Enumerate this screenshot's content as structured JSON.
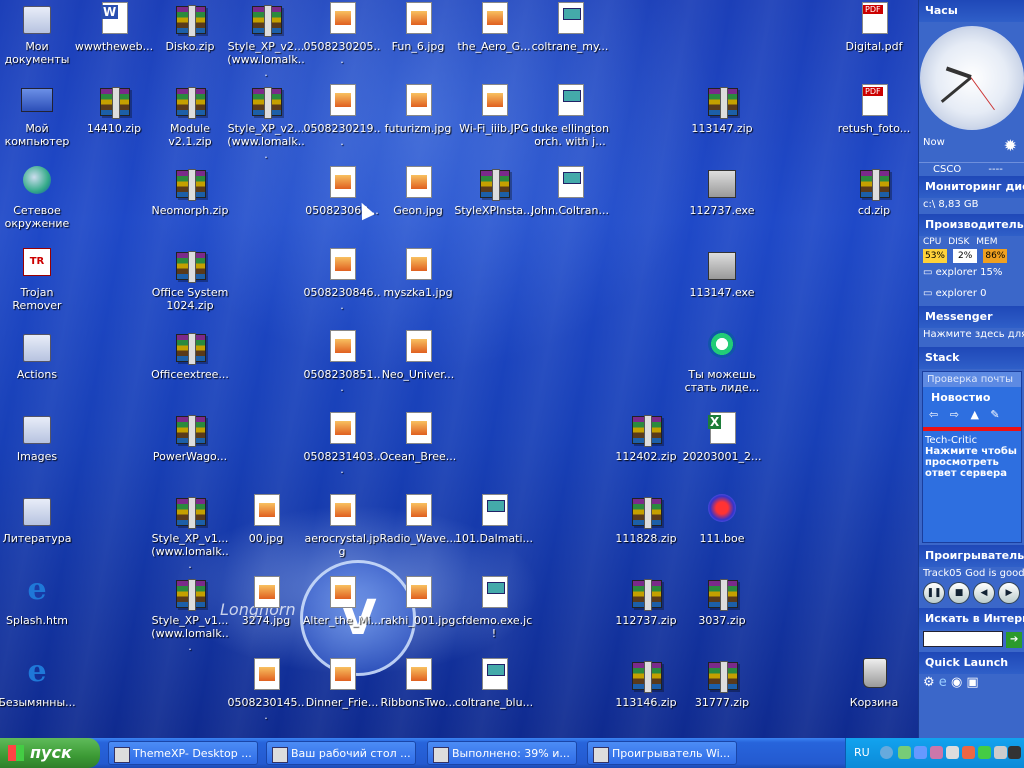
{
  "desktop": {
    "icons": [
      {
        "label": "Мои документы",
        "type": "folder"
      },
      {
        "label": "wwwtheweb...",
        "type": "word"
      },
      {
        "label": "Disko.zip",
        "type": "zip"
      },
      {
        "label": "Style_XP_v2... (www.lomalk...",
        "type": "zip"
      },
      {
        "label": "0508230205...",
        "type": "img"
      },
      {
        "label": "Fun_6.jpg",
        "type": "img"
      },
      {
        "label": "the_Aero_G...",
        "type": "img"
      },
      {
        "label": "coltrane_my...",
        "type": "doc"
      },
      {
        "label": "Digital.pdf",
        "type": "pdf"
      },
      {
        "label": "Мой компьютер",
        "type": "comp"
      },
      {
        "label": "14410.zip",
        "type": "zip"
      },
      {
        "label": "Module v2.1.zip",
        "type": "zip"
      },
      {
        "label": "Style_XP_v2... (www.lomalk...",
        "type": "zip"
      },
      {
        "label": "0508230219...",
        "type": "img"
      },
      {
        "label": "futurizm.jpg",
        "type": "img"
      },
      {
        "label": "Wi-Fi_iiib.JPG",
        "type": "img"
      },
      {
        "label": "duke ellington orch. with j...",
        "type": "doc"
      },
      {
        "label": "113147.zip",
        "type": "zip"
      },
      {
        "label": "retush_foto...",
        "type": "pdf"
      },
      {
        "label": "Сетевое окружение",
        "type": "globe"
      },
      {
        "label": "Neomorph.zip",
        "type": "zip"
      },
      {
        "label": "050823063...",
        "type": "img"
      },
      {
        "label": "Geon.jpg",
        "type": "img"
      },
      {
        "label": "StyleXPInsta...",
        "type": "zip"
      },
      {
        "label": "John.Coltran...",
        "type": "doc"
      },
      {
        "label": "112737.exe",
        "type": "exe"
      },
      {
        "label": "cd.zip",
        "type": "zip"
      },
      {
        "label": "Trojan Remover",
        "type": "trojan"
      },
      {
        "label": "Office System 1024.zip",
        "type": "zip"
      },
      {
        "label": "0508230846...",
        "type": "img"
      },
      {
        "label": "myszka1.jpg",
        "type": "img"
      },
      {
        "label": "113147.exe",
        "type": "exe"
      },
      {
        "label": "Actions",
        "type": "folder"
      },
      {
        "label": "Officeextree...",
        "type": "zip"
      },
      {
        "label": "0508230851...",
        "type": "img"
      },
      {
        "label": "Neo_Univer...",
        "type": "img"
      },
      {
        "label": "Ты можешь стать лиде...",
        "type": "media"
      },
      {
        "label": "Images",
        "type": "folder"
      },
      {
        "label": "PowerWago...",
        "type": "zip"
      },
      {
        "label": "0508231403...",
        "type": "img"
      },
      {
        "label": "Ocean_Bree...",
        "type": "img"
      },
      {
        "label": "112402.zip",
        "type": "zip"
      },
      {
        "label": "20203001_2...",
        "type": "xls"
      },
      {
        "label": "Литература",
        "type": "folder"
      },
      {
        "label": "Style_XP_v1... (www.lomalk...",
        "type": "zip"
      },
      {
        "label": "00.jpg",
        "type": "img"
      },
      {
        "label": "aerocrystal.jpg",
        "type": "img"
      },
      {
        "label": "Radio_Wave...",
        "type": "img"
      },
      {
        "label": "101.Dalmati...",
        "type": "doc"
      },
      {
        "label": "111828.zip",
        "type": "zip"
      },
      {
        "label": "111.boe",
        "type": "boe"
      },
      {
        "label": "Splash.htm",
        "type": "ie"
      },
      {
        "label": "Style_XP_v1... (www.lomalk...",
        "type": "zip"
      },
      {
        "label": "3274.jpg",
        "type": "img"
      },
      {
        "label": "Alter_the_Mi...",
        "type": "img"
      },
      {
        "label": "rakhi_001.jpg",
        "type": "img"
      },
      {
        "label": "cfdemo.exe.jc!",
        "type": "doc"
      },
      {
        "label": "112737.zip",
        "type": "zip"
      },
      {
        "label": "3037.zip",
        "type": "zip"
      },
      {
        "label": "Безымянны...",
        "type": "ie"
      },
      {
        "label": "0508230145...",
        "type": "img"
      },
      {
        "label": "Dinner_Frie...",
        "type": "img"
      },
      {
        "label": "RibbonsTwo...",
        "type": "img"
      },
      {
        "label": "coltrane_blu...",
        "type": "doc"
      },
      {
        "label": "113146.zip",
        "type": "zip"
      },
      {
        "label": "31777.zip",
        "type": "zip"
      },
      {
        "label": "Корзина",
        "type": "bin"
      }
    ],
    "watermark_text": "Longhorn"
  },
  "sidebar": {
    "clock_title": "Часы",
    "clock_time": {
      "hour": 9,
      "minute": 38,
      "second": 24
    },
    "now_label": "Now",
    "stock_symbol": "CSCO",
    "stock_value": "----",
    "disk_title": "Мониторинг дис",
    "disk_text": "c:\\ 8,83 GB",
    "perf_title": "Производитель",
    "perf_labels": [
      "CPU",
      "DISK",
      "MEM"
    ],
    "perf_values": [
      "53%",
      "2%",
      "86%"
    ],
    "perf_proc1": "explorer 15%",
    "perf_proc2": "explorer 0",
    "messenger_title": "Messenger",
    "messenger_text": "Нажмите здесь для",
    "stack_title": "Stack",
    "stack_check": "Проверка почты",
    "stack_news": "Новостио",
    "stack_source": "Tech-Critic",
    "stack_msg": "Нажмите чтобы просмотреть ответ сервера",
    "player_title": "Проигрыватель",
    "player_track": "Track05 God is good",
    "player_buttons": [
      "pause",
      "stop",
      "prev",
      "next"
    ],
    "search_title": "Искать в Интерн",
    "search_value": "",
    "quicklaunch_title": "Quick Launch"
  },
  "taskbar": {
    "start_label": "пуск",
    "tasks": [
      "ThemeXP- Desktop ...",
      "Ваш рабочий стол ...",
      "Выполнено: 39% и...",
      "Проигрыватель Wi..."
    ],
    "lang": "RU"
  },
  "colors": {
    "desktop_bg": "#1f49c8",
    "taskbar": "#245ad0",
    "start_green": "#3c9a35",
    "sidebar_bg": "#3b67c9",
    "tray": "#0c8ad8"
  }
}
